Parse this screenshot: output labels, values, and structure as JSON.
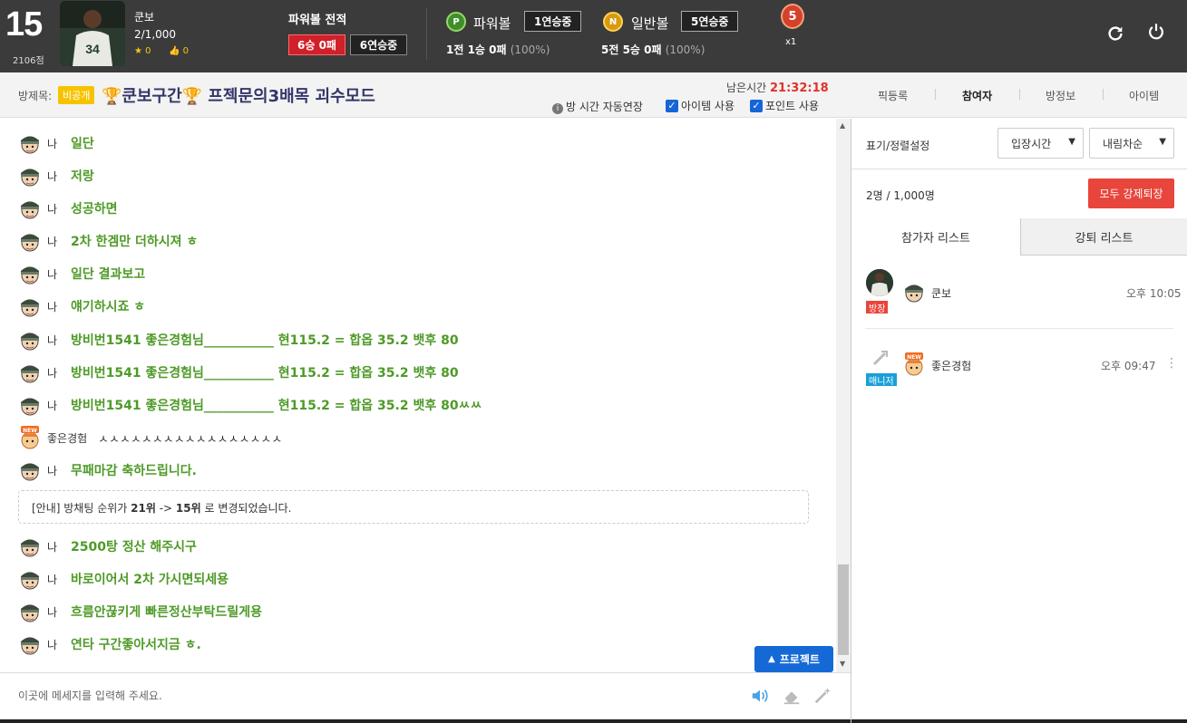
{
  "header": {
    "level": "15",
    "points": "2106점",
    "username": "쿤보",
    "count": "2/1,000",
    "stars": "0",
    "likes": "0",
    "powerball_record_title": "파워볼 전적",
    "record_badge": "6승 0패",
    "streak_badge": "6연승중",
    "powerball": {
      "ball": "P",
      "label": "파워볼",
      "streak": "1연승중",
      "record": "1전 1승 0패",
      "pct": "(100%)"
    },
    "normalball": {
      "ball": "N",
      "label": "일반볼",
      "streak": "5연승중",
      "record": "5전 5승 0패",
      "pct": "(100%)"
    },
    "medal": {
      "value": "5",
      "multiplier": "x1"
    },
    "colors": {
      "bar_bg": "#3b3b3b",
      "win_red": "#d0202a"
    }
  },
  "room": {
    "label": "방제목:",
    "private_badge": "비공개",
    "trophy": "🏆",
    "title_name": "쿤보구간",
    "title_rest": " 프젝문의3배목 괴수모드",
    "remaining_label": "남은시간",
    "remaining_time": "21:32:18",
    "auto_extend": "방 시간 자동연장",
    "item_use": "아이템 사용",
    "point_use": "포인트 사용",
    "tabs": [
      "픽등록",
      "참여자",
      "방정보",
      "아이템"
    ],
    "active_tab": "참여자"
  },
  "chat": {
    "me_label": "나",
    "messages": [
      {
        "who": "나",
        "text": "일단",
        "mine": true
      },
      {
        "who": "나",
        "text": "저랑",
        "mine": true
      },
      {
        "who": "나",
        "text": "성공하면",
        "mine": true
      },
      {
        "who": "나",
        "text": "2차 한겜만 더하시져 ㅎ",
        "mine": true
      },
      {
        "who": "나",
        "text": "일단 결과보고",
        "mine": true
      },
      {
        "who": "나",
        "text": "얘기하시죠 ㅎ",
        "mine": true
      },
      {
        "who": "나",
        "text": "방비번1541 좋은경험님___________ 현115.2 = 합옵 35.2 뱃후 80",
        "mine": true
      },
      {
        "who": "나",
        "text": "방비번1541 좋은경험님___________ 현115.2 = 합옵 35.2 뱃후 80",
        "mine": true
      },
      {
        "who": "나",
        "text": "방비번1541 좋은경험님___________ 현115.2 = 합옵 35.2 뱃후 80ㅆㅆ",
        "mine": true
      },
      {
        "who": "좋은경험",
        "text": "ㅅㅅㅅㅅㅅㅅㅅㅅㅅㅅㅅㅅㅅㅅㅅㅅㅅ",
        "mine": false
      },
      {
        "who": "나",
        "text": "무패마감 축하드립니다.",
        "mine": true
      },
      {
        "who": "나",
        "text": "2500탕 정산 해주시구",
        "mine": true
      },
      {
        "who": "나",
        "text": "바로이어서 2차 가시면되세용",
        "mine": true
      },
      {
        "who": "나",
        "text": "흐름안끊키게 빠른정산부탁드릴게용",
        "mine": true
      },
      {
        "who": "나",
        "text": "연타 구간좋아서지금 ㅎ.",
        "mine": true
      }
    ],
    "notice": {
      "prefix": "[안내] 방채팅 순위가 ",
      "from": "21위",
      "arrow": " -> ",
      "to": "15위",
      "suffix": " 로 변경되었습니다."
    },
    "protect_button": "프로젝트",
    "input_placeholder": "이곳에 메세지를 입력해 주세요."
  },
  "panel": {
    "sort_label": "표기/정렬설정",
    "sort_select": "입장시간",
    "order_select": "내림차순",
    "member_count": "2명",
    "member_total": "/ 1,000명",
    "kick_all": "모두 강제퇴장",
    "tab_participants": "참가자 리스트",
    "tab_kicked": "강퇴 리스트",
    "members": [
      {
        "name": "쿤보",
        "role": "방장",
        "time": "오후 10:05"
      },
      {
        "name": "좋은경험",
        "role": "매니저",
        "time": "오후 09:47"
      }
    ]
  }
}
